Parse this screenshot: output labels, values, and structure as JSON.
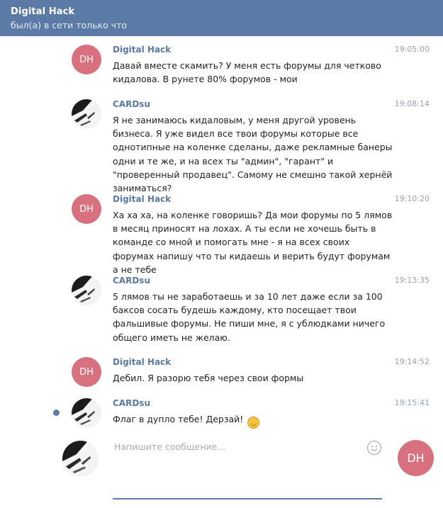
{
  "header": {
    "title": "Digital Hack",
    "status": "был(а) в сети только что"
  },
  "messages": [
    {
      "author": "Digital Hack",
      "initials": "DH",
      "time": "19:05:00",
      "text": "Давай вместе скамить? У меня есть форумы для четково кидалова. В рунете 80% форумов - мои"
    },
    {
      "author": "CARDsu",
      "initials": "",
      "time": "19:08:14",
      "text": "Я не занимаюсь кидаловым, у меня другой уровень бизнеса. Я уже видел все твои форумы которые все однотипные на коленке сделаны, даже рекламные банеры одни и те же, и на всех ты \"админ\", \"гарант\" и \"проверенный продавец\". Самому не смешно такой хернёй заниматься?"
    },
    {
      "author": "Digital Hack",
      "initials": "DH",
      "time": "19:10:20",
      "text": "Ха ха ха, на коленке говоришь? Да мои форумы по 5 лямов в месяц приносят на лохах. А ты если не хочешь быть в команде со мной и помогать мне - я на всех своих форумах напишу что ты кидаешь и верить будут форумам а не тебе"
    },
    {
      "author": "CARDsu",
      "initials": "",
      "time": "19:13:35",
      "text": "5 лямов ты не заработаешь и за 10 лет даже если за 100 баксов сосать будешь каждому, кто посещает твои фальшивые форумы. Не пиши мне, я с ублюдками ничего общего иметь не желаю."
    },
    {
      "author": "Digital Hack",
      "initials": "DH",
      "time": "19:14:52",
      "text": "Дебил. Я разорю тебя через свои формы"
    },
    {
      "author": "CARDsu",
      "initials": "",
      "time": "19:15:41",
      "text": "Флаг в дупло тебе! Дерзай!",
      "emoji": "😁"
    }
  ],
  "composer": {
    "placeholder": "Напишите сообщение...",
    "send_initials": "DH"
  },
  "colors": {
    "header": "#5b7aa5",
    "name": "#5a7aa3",
    "avatar_dh": "#d9707e"
  }
}
